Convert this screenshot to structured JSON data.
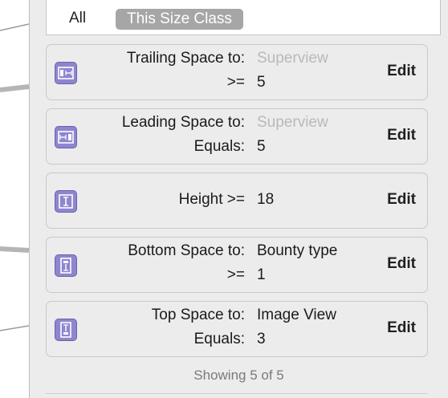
{
  "segments": {
    "all_label": "All",
    "size_class_label": "This Size Class"
  },
  "constraints": [
    {
      "line1_label": "Trailing Space to:",
      "line1_value": "Superview",
      "line2_label": ">=",
      "line2_value": "5",
      "edit": "Edit",
      "icon": "trailing-space-icon"
    },
    {
      "line1_label": "Leading Space to:",
      "line1_value": "Superview",
      "line2_label": "Equals:",
      "line2_value": "5",
      "edit": "Edit",
      "icon": "leading-space-icon"
    },
    {
      "line1_label": "Height >=",
      "line1_value": "18",
      "edit": "Edit",
      "icon": "height-icon"
    },
    {
      "line1_label": "Bottom Space to:",
      "line1_value": "Bounty type",
      "line2_label": ">=",
      "line2_value": "1",
      "edit": "Edit",
      "icon": "bottom-space-icon"
    },
    {
      "line1_label": "Top Space to:",
      "line1_value": "Image View",
      "line2_label": "Equals:",
      "line2_value": "3",
      "edit": "Edit",
      "icon": "top-space-icon"
    }
  ],
  "footer": {
    "showing": "Showing 5 of 5"
  },
  "colors": {
    "icon_fill": "#8d86cf",
    "selected_segment": "#a6a6a6",
    "muted_text": "#b9b9b9"
  }
}
